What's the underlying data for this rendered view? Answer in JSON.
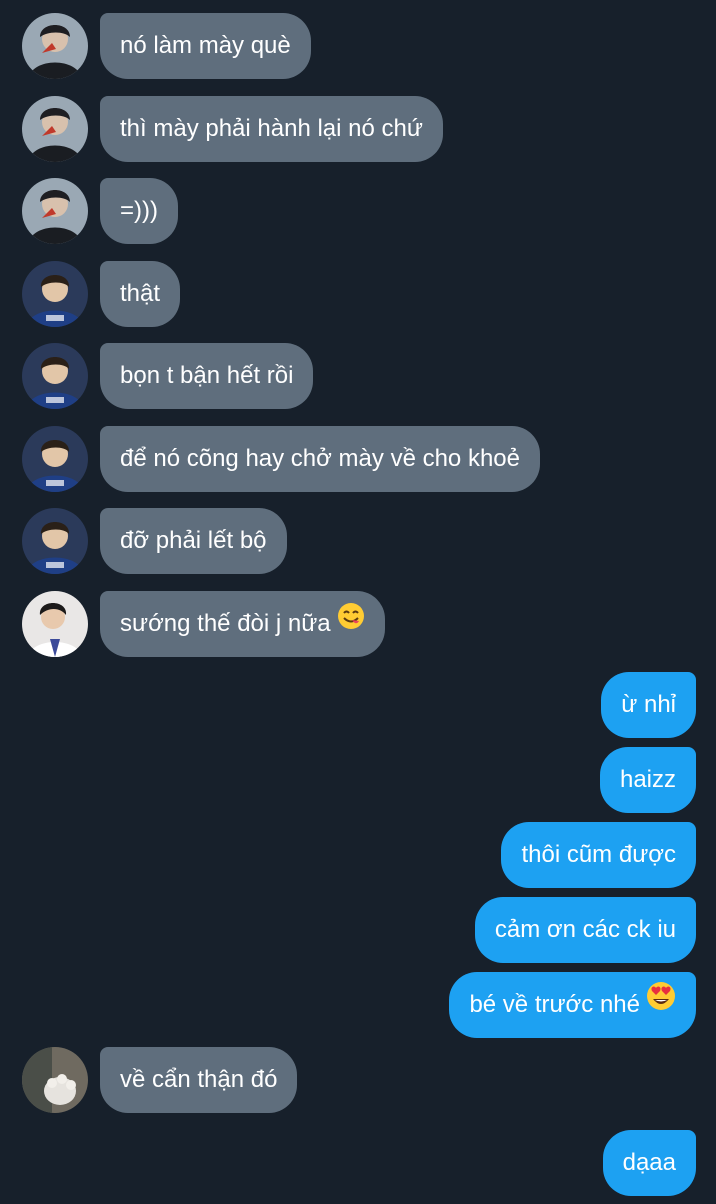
{
  "conversation": {
    "messages": [
      {
        "side": "in",
        "avatar": "photo-dark-jacket",
        "text": "nó làm mày què"
      },
      {
        "side": "in",
        "avatar": "photo-dark-jacket",
        "text": "thì mày phải hành lại nó chứ"
      },
      {
        "side": "in",
        "avatar": "photo-dark-jacket",
        "text": "=)))"
      },
      {
        "side": "in",
        "avatar": "photo-blue-jersey",
        "text": "thật"
      },
      {
        "side": "in",
        "avatar": "photo-blue-jersey",
        "text": "bọn t bận hết rồi"
      },
      {
        "side": "in",
        "avatar": "photo-blue-jersey",
        "text": "để nó cõng hay chở mày về cho khoẻ"
      },
      {
        "side": "in",
        "avatar": "photo-blue-jersey",
        "text": "đỡ phải lết bộ"
      },
      {
        "side": "in",
        "avatar": "photo-white-shirt",
        "text": "sướng thế đòi j nữa",
        "emoji": "yum-emoji"
      },
      {
        "side": "out",
        "text": "ừ nhỉ"
      },
      {
        "side": "out",
        "text": "haizz"
      },
      {
        "side": "out",
        "text": "thôi cũm được"
      },
      {
        "side": "out",
        "text": "cảm ơn các ck iu"
      },
      {
        "side": "out",
        "text": "bé về trước nhé",
        "emoji": "heart-eyes-emoji"
      },
      {
        "side": "in",
        "avatar": "photo-cat-paw",
        "text": "về cẩn thận đó"
      },
      {
        "side": "out",
        "text": "dạaa"
      }
    ]
  },
  "colors": {
    "background": "#17202b",
    "incoming_bubble": "#5f6e7d",
    "outgoing_bubble": "#1da1f2",
    "text": "#ffffff"
  }
}
